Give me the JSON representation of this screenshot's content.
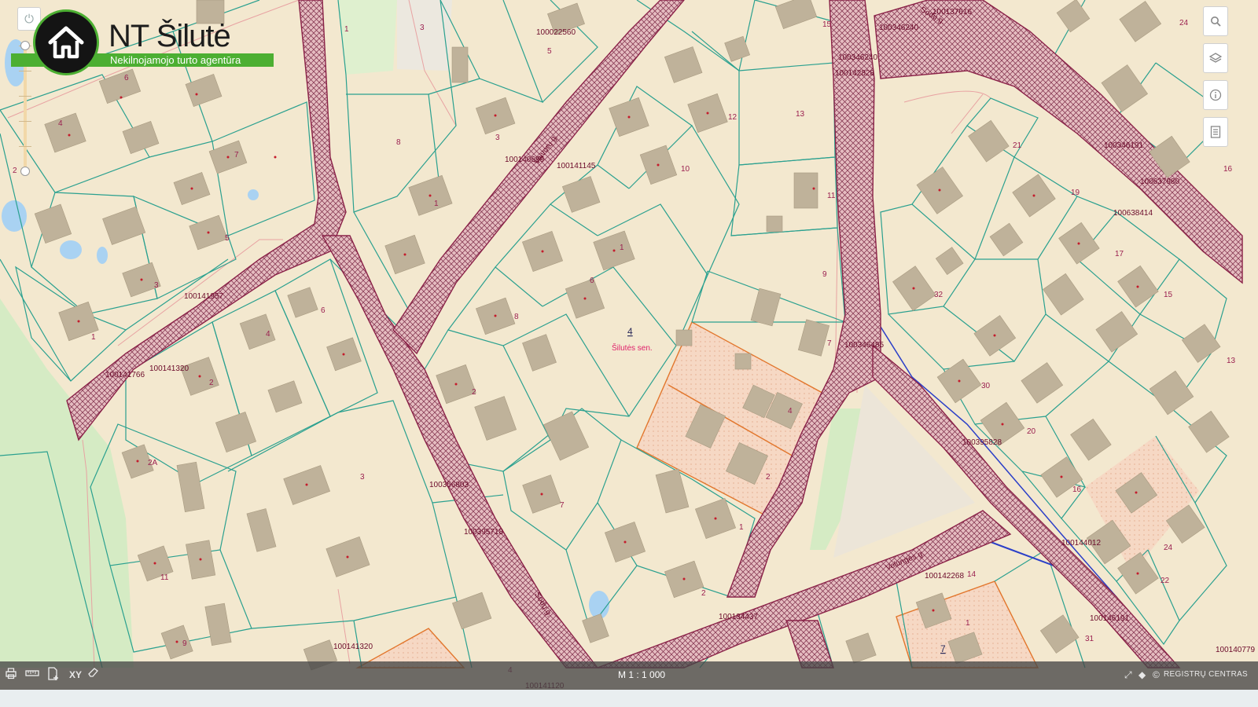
{
  "logo": {
    "title": "NT Šilutė",
    "subtitle": "Nekilnojamojo turto agentūra",
    "icon": "house-icon"
  },
  "map": {
    "center_label": "Šilutės sen.",
    "center_number": "4",
    "parcel_ids": [
      {
        "t": "100022560"
      },
      {
        "t": "100137616"
      },
      {
        "t": "100346240"
      },
      {
        "t": "100346240"
      },
      {
        "t": "100142828"
      },
      {
        "t": "100140689"
      },
      {
        "t": "100141145"
      },
      {
        "t": "100346191"
      },
      {
        "t": "100637980"
      },
      {
        "t": "100638414"
      },
      {
        "t": "100141957"
      },
      {
        "t": "100141766"
      },
      {
        "t": "100141320"
      },
      {
        "t": "100346485"
      },
      {
        "t": "100395828"
      },
      {
        "t": "100356803"
      },
      {
        "t": "100395718"
      },
      {
        "t": "100144012"
      },
      {
        "t": "100142268"
      },
      {
        "t": "100134437"
      },
      {
        "t": "100146191"
      },
      {
        "t": "100141320"
      },
      {
        "t": "100141120"
      },
      {
        "t": "100140779"
      }
    ],
    "parcel_numbers": [
      "1",
      "3",
      "5",
      "15",
      "24",
      "6",
      "4",
      "2",
      "7",
      "8",
      "3",
      "1",
      "12",
      "13",
      "10",
      "11",
      "21",
      "19",
      "16",
      "6",
      "9",
      "1",
      "5",
      "3",
      "1",
      "8",
      "4",
      "6",
      "2",
      "7",
      "4",
      "32",
      "15",
      "17",
      "30",
      "20",
      "13",
      "2",
      "16",
      "24",
      "22",
      "14",
      "31",
      "2A",
      "3",
      "2",
      "1",
      "11",
      "9",
      "4",
      "2",
      "7",
      "1"
    ],
    "street_labels": [
      "Sodų g.",
      "Vaivorų g.",
      "Volungės g.",
      "Sodų g."
    ]
  },
  "toolbar_right": {
    "search": "search-icon",
    "layers": "layers-icon",
    "info": "info-icon",
    "legend": "legend-icon"
  },
  "bottom_bar": {
    "scale": "M 1 : 1 000",
    "coords": "XY",
    "provider": "REGISTRŲ CENTRAS"
  },
  "colors": {
    "map_bg": "#f3e8cf",
    "parcel_line": "#2aa08f",
    "road_outline": "#8a2248",
    "logo_green": "#4caf32"
  }
}
